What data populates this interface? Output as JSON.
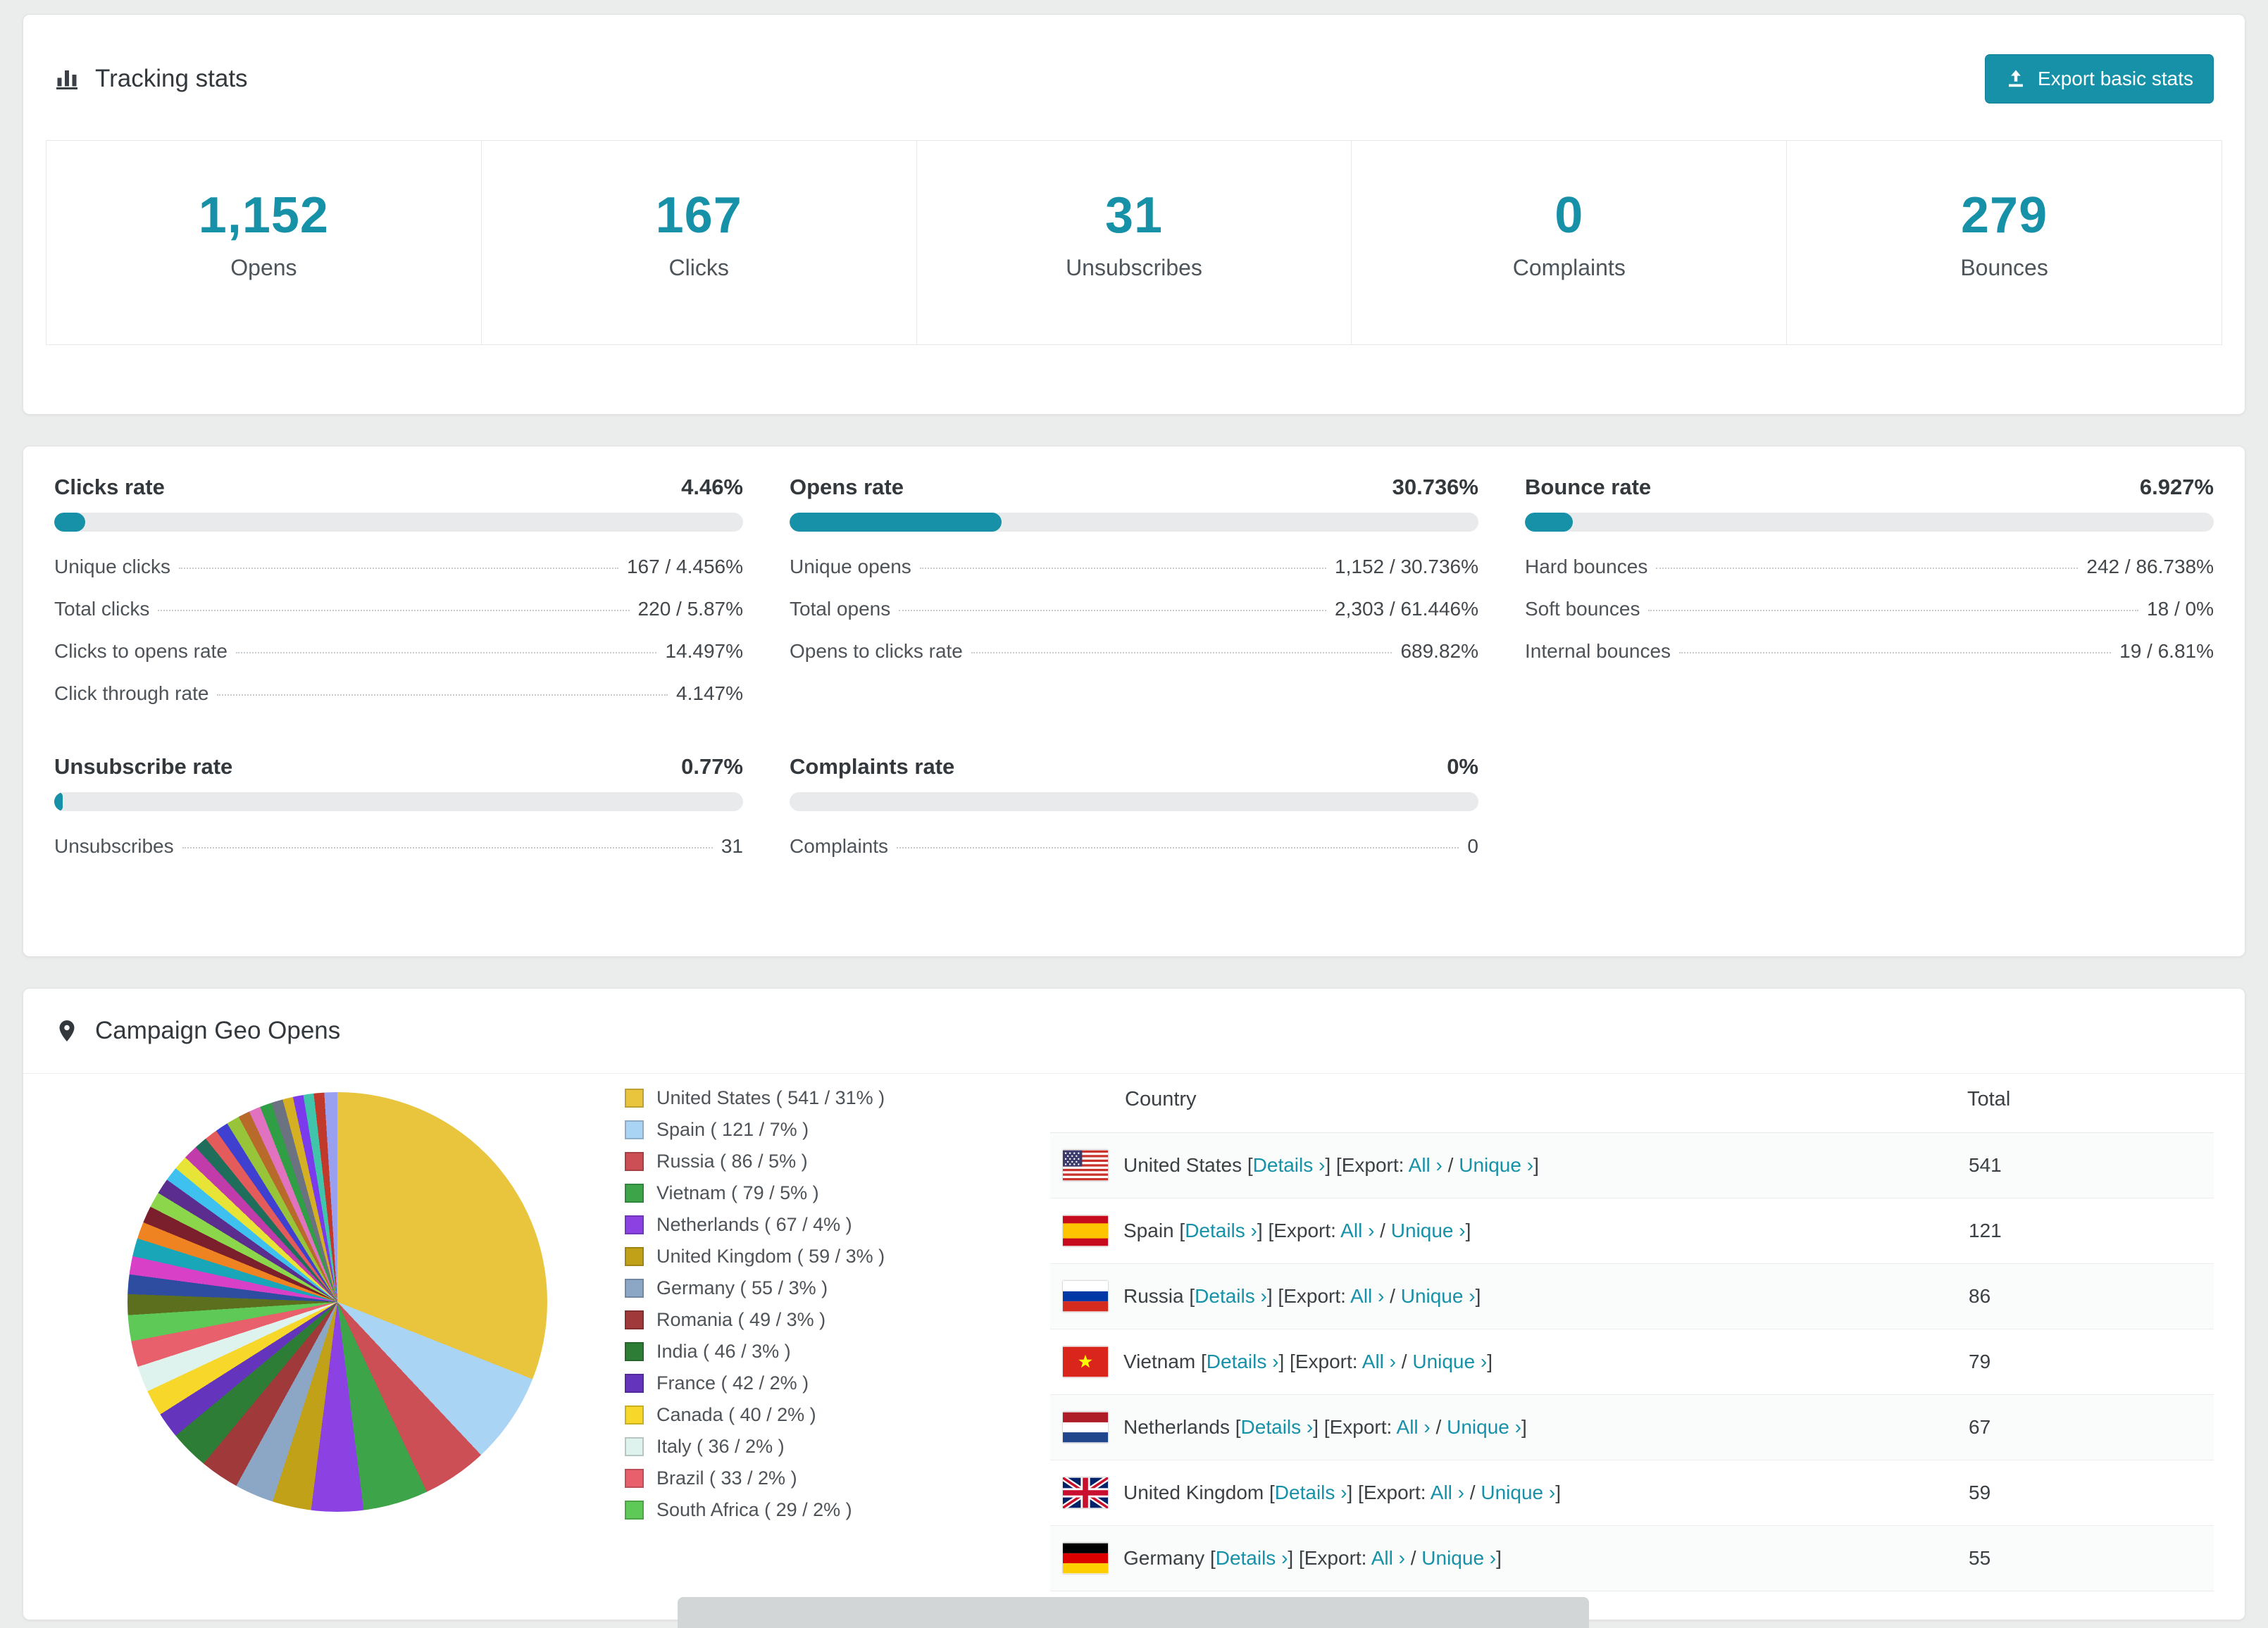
{
  "theme": {
    "accent": "#1791a8",
    "track": "#e9eaeb",
    "link": "#1791a8"
  },
  "tracking": {
    "title": "Tracking stats",
    "export_button": "Export basic stats",
    "stats": [
      {
        "value": "1,152",
        "label": "Opens"
      },
      {
        "value": "167",
        "label": "Clicks"
      },
      {
        "value": "31",
        "label": "Unsubscribes"
      },
      {
        "value": "0",
        "label": "Complaints"
      },
      {
        "value": "279",
        "label": "Bounces"
      }
    ]
  },
  "rates": {
    "panels": [
      {
        "id": "clicks-rate",
        "title": "Clicks rate",
        "value": "4.46%",
        "pct": 4.46,
        "rows": [
          {
            "label": "Unique clicks",
            "value": "167 / 4.456%"
          },
          {
            "label": "Total clicks",
            "value": "220 / 5.87%"
          },
          {
            "label": "Clicks to opens rate",
            "value": "14.497%"
          },
          {
            "label": "Click through rate",
            "value": "4.147%"
          }
        ]
      },
      {
        "id": "opens-rate",
        "title": "Opens rate",
        "value": "30.736%",
        "pct": 30.736,
        "rows": [
          {
            "label": "Unique opens",
            "value": "1,152 / 30.736%"
          },
          {
            "label": "Total opens",
            "value": "2,303 / 61.446%"
          },
          {
            "label": "Opens to clicks rate",
            "value": "689.82%"
          }
        ]
      },
      {
        "id": "bounce-rate",
        "title": "Bounce rate",
        "value": "6.927%",
        "pct": 6.927,
        "rows": [
          {
            "label": "Hard bounces",
            "value": "242 / 86.738%"
          },
          {
            "label": "Soft bounces",
            "value": "18 / 0%"
          },
          {
            "label": "Internal bounces",
            "value": "19 / 6.81%"
          }
        ]
      },
      {
        "id": "unsubscribe-rate",
        "title": "Unsubscribe rate",
        "value": "0.77%",
        "pct": 0.77,
        "rows": [
          {
            "label": "Unsubscribes",
            "value": "31"
          }
        ]
      },
      {
        "id": "complaints-rate",
        "title": "Complaints rate",
        "value": "0%",
        "pct": 0,
        "rows": [
          {
            "label": "Complaints",
            "value": "0"
          }
        ]
      }
    ]
  },
  "geo": {
    "title": "Campaign Geo Opens",
    "table": {
      "headers": [
        "Country",
        "Total"
      ],
      "tokens": {
        "lb": "[",
        "rb": "]",
        "details": "Details ›",
        "export_prefix": "Export:",
        "all": "All ›",
        "slash": "/",
        "unique": "Unique ›"
      },
      "rows": [
        {
          "country": "United States",
          "flag": "us",
          "total": "541"
        },
        {
          "country": "Spain",
          "flag": "es",
          "total": "121"
        },
        {
          "country": "Russia",
          "flag": "ru",
          "total": "86"
        },
        {
          "country": "Vietnam",
          "flag": "vn",
          "total": "79"
        },
        {
          "country": "Netherlands",
          "flag": "nl",
          "total": "67"
        },
        {
          "country": "United Kingdom",
          "flag": "gb",
          "total": "59"
        },
        {
          "country": "Germany",
          "flag": "de",
          "total": "55"
        }
      ]
    }
  },
  "chart_data": {
    "type": "pie",
    "title": "Campaign Geo Opens",
    "legend_position": "right",
    "slices": [
      {
        "label": "United States",
        "value": 541,
        "pct": 31,
        "color": "#e9c43d"
      },
      {
        "label": "Spain",
        "value": 121,
        "pct": 7,
        "color": "#aad4f4"
      },
      {
        "label": "Russia",
        "value": 86,
        "pct": 5,
        "color": "#cc4f55"
      },
      {
        "label": "Vietnam",
        "value": 79,
        "pct": 5,
        "color": "#3da44a"
      },
      {
        "label": "Netherlands",
        "value": 67,
        "pct": 4,
        "color": "#8c42e3"
      },
      {
        "label": "United Kingdom",
        "value": 59,
        "pct": 3,
        "color": "#c0a118"
      },
      {
        "label": "Germany",
        "value": 55,
        "pct": 3,
        "color": "#8ca6c6"
      },
      {
        "label": "Romania",
        "value": 49,
        "pct": 3,
        "color": "#a03a3a"
      },
      {
        "label": "India",
        "value": 46,
        "pct": 3,
        "color": "#2e7d36"
      },
      {
        "label": "France",
        "value": 42,
        "pct": 2,
        "color": "#6434bd"
      },
      {
        "label": "Canada",
        "value": 40,
        "pct": 2,
        "color": "#f6d72a"
      },
      {
        "label": "Italy",
        "value": 36,
        "pct": 2,
        "color": "#dff3ee"
      },
      {
        "label": "Brazil",
        "value": 33,
        "pct": 2,
        "color": "#e7606b"
      },
      {
        "label": "South Africa",
        "value": 29,
        "pct": 2,
        "color": "#5ec957"
      }
    ],
    "other_slices": [
      {
        "color": "#5b6f1f",
        "pct": 1.6
      },
      {
        "color": "#2e4ca0",
        "pct": 1.5
      },
      {
        "color": "#d840c8",
        "pct": 1.4
      },
      {
        "color": "#19a6b8",
        "pct": 1.4
      },
      {
        "color": "#ef8322",
        "pct": 1.3
      },
      {
        "color": "#7a1f2b",
        "pct": 1.3
      },
      {
        "color": "#8bd64b",
        "pct": 1.2
      },
      {
        "color": "#5b2d8e",
        "pct": 1.2
      },
      {
        "color": "#3fc1f0",
        "pct": 1.1
      },
      {
        "color": "#e8e337",
        "pct": 1.1
      },
      {
        "color": "#c23baa",
        "pct": 1.1
      },
      {
        "color": "#1f6e5c",
        "pct": 1.0
      },
      {
        "color": "#e45b5b",
        "pct": 1.0
      },
      {
        "color": "#4040d0",
        "pct": 1.0
      },
      {
        "color": "#97c439",
        "pct": 1.0
      },
      {
        "color": "#b86a2b",
        "pct": 0.9
      },
      {
        "color": "#e072c0",
        "pct": 0.9
      },
      {
        "color": "#2f9e44",
        "pct": 0.9
      },
      {
        "color": "#6b7280",
        "pct": 0.9
      },
      {
        "color": "#d4b022",
        "pct": 0.8
      },
      {
        "color": "#7c3aed",
        "pct": 0.8
      },
      {
        "color": "#40c4aa",
        "pct": 0.8
      },
      {
        "color": "#c0392b",
        "pct": 0.8
      },
      {
        "color": "#9aa0f0",
        "pct": 1.0
      }
    ]
  }
}
